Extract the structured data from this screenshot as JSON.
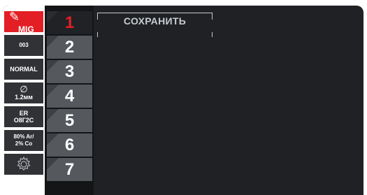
{
  "sidebar": {
    "process": "MIG",
    "items": [
      {
        "id": "program",
        "label": "003"
      },
      {
        "id": "mode",
        "label": "NORMAL"
      },
      {
        "id": "diameter_symbol",
        "label": "∅"
      },
      {
        "id": "diameter",
        "label": "1.2мм"
      },
      {
        "id": "wire_l1",
        "label": "ER"
      },
      {
        "id": "wire_l2",
        "label": "О8Г2С"
      },
      {
        "id": "gas_l1",
        "label": "80% Ar/"
      },
      {
        "id": "gas_l2",
        "label": "2% Co"
      }
    ]
  },
  "slots": [
    {
      "label": "1",
      "active": true
    },
    {
      "label": "2",
      "active": false
    },
    {
      "label": "3",
      "active": false
    },
    {
      "label": "4",
      "active": false
    },
    {
      "label": "5",
      "active": false
    },
    {
      "label": "6",
      "active": false
    },
    {
      "label": "7",
      "active": false
    }
  ],
  "actions": {
    "save_label": "СОХРАНИТЬ"
  },
  "colors": {
    "accent": "#e31e24",
    "panel": "#1f2124"
  }
}
